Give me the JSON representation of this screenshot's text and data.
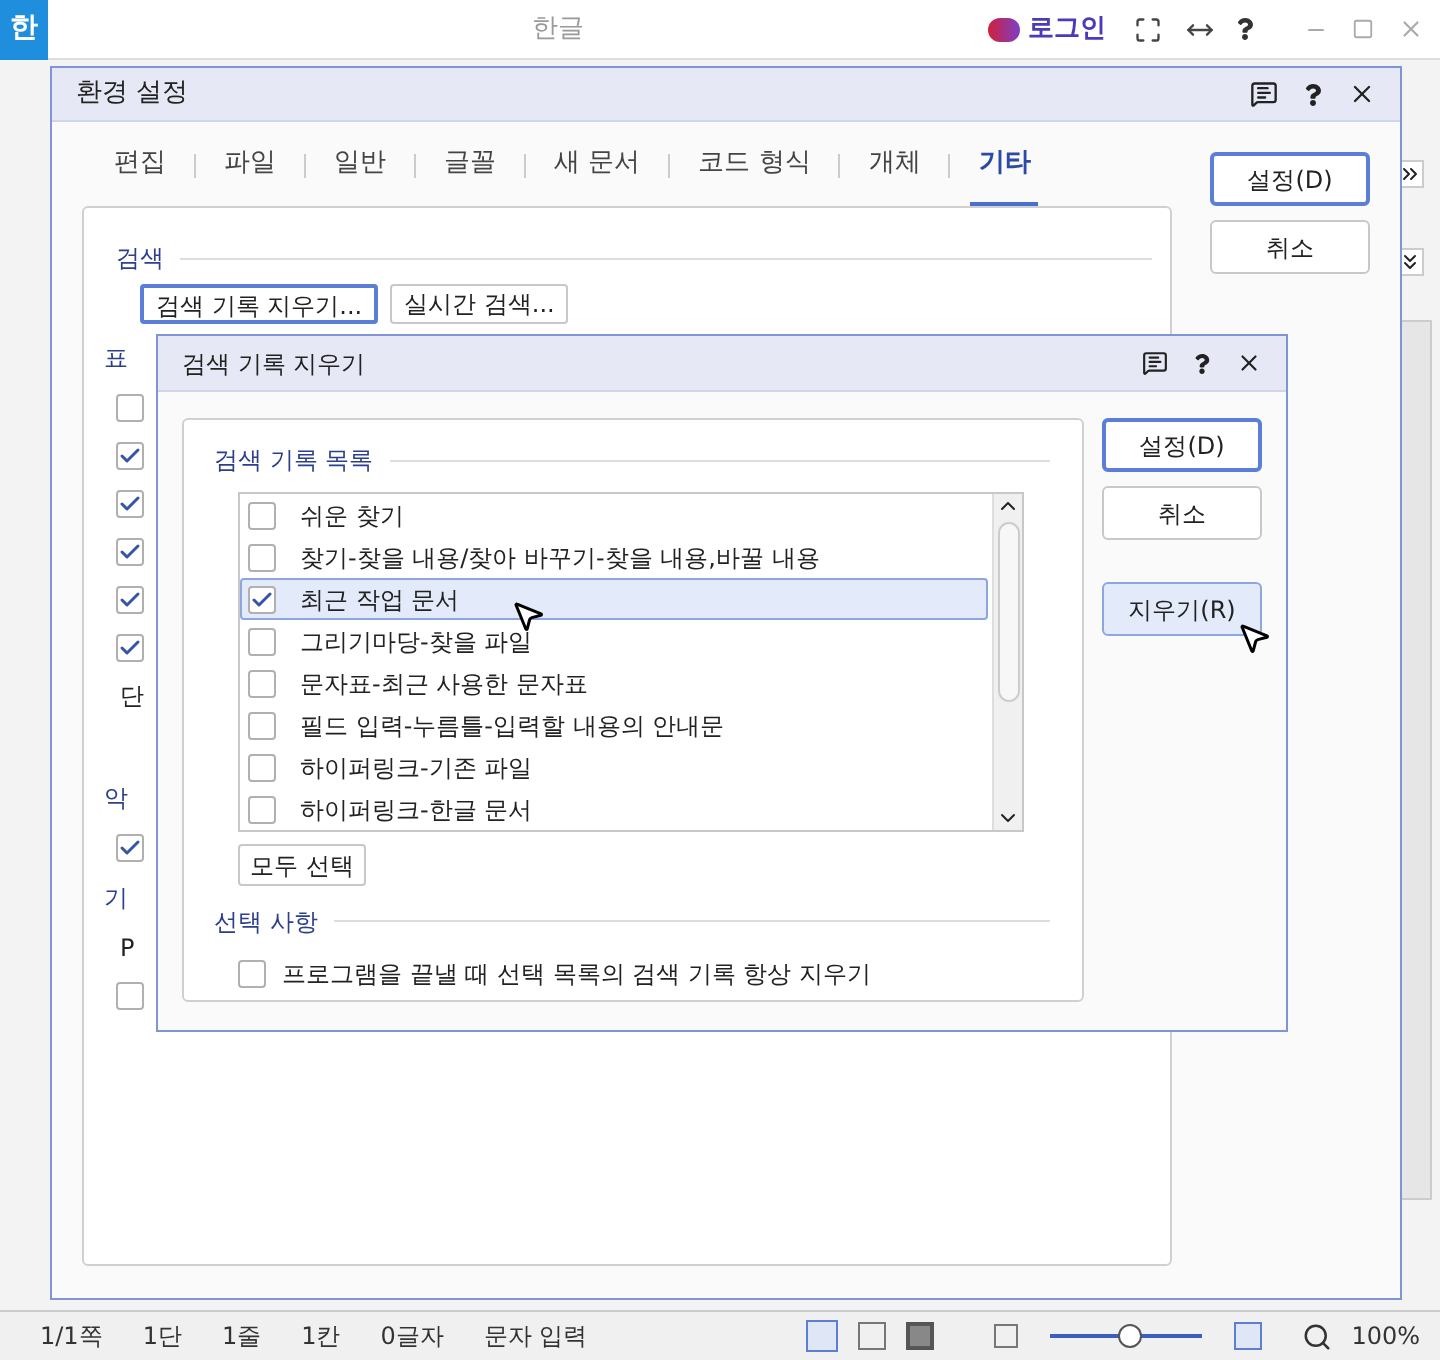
{
  "app": {
    "logo": "한",
    "title": "한글",
    "login": "로그인"
  },
  "settings_dialog": {
    "title": "환경 설정",
    "tabs": [
      {
        "label": "편집",
        "selected": false
      },
      {
        "label": "파일",
        "selected": false
      },
      {
        "label": "일반",
        "selected": false
      },
      {
        "label": "글꼴",
        "selected": false
      },
      {
        "label": "새 문서",
        "selected": false
      },
      {
        "label": "코드 형식",
        "selected": false
      },
      {
        "label": "개체",
        "selected": false
      },
      {
        "label": "기타",
        "selected": true
      }
    ],
    "buttons": [
      "설정(D)",
      "취소"
    ],
    "search_section": {
      "heading": "검색",
      "buttons": [
        "검색 기록 지우기...",
        "실시간 검색..."
      ]
    },
    "left_strip": [
      {
        "kind": "heading",
        "text": "표"
      },
      {
        "kind": "checkbox",
        "checked": false
      },
      {
        "kind": "checkbox",
        "checked": true
      },
      {
        "kind": "checkbox",
        "checked": true
      },
      {
        "kind": "checkbox",
        "checked": true
      },
      {
        "kind": "checkbox",
        "checked": true
      },
      {
        "kind": "checkbox",
        "checked": true
      },
      {
        "kind": "text",
        "text": "단"
      },
      {
        "kind": "gap"
      },
      {
        "kind": "heading",
        "text": "악"
      },
      {
        "kind": "checkbox",
        "checked": true
      },
      {
        "kind": "heading",
        "text": "기"
      },
      {
        "kind": "text",
        "text": "P"
      },
      {
        "kind": "checkbox",
        "checked": false
      }
    ]
  },
  "clear_history_dialog": {
    "title": "검색 기록 지우기",
    "list_heading": "검색 기록 목록",
    "items": [
      {
        "label": "쉬운 찾기",
        "checked": false,
        "selected": false
      },
      {
        "label": "찾기-찾을 내용/찾아 바꾸기-찾을 내용,바꿀 내용",
        "checked": false,
        "selected": false
      },
      {
        "label": "최근 작업 문서",
        "checked": true,
        "selected": true
      },
      {
        "label": "그리기마당-찾을 파일",
        "checked": false,
        "selected": false
      },
      {
        "label": "문자표-최근 사용한 문자표",
        "checked": false,
        "selected": false
      },
      {
        "label": "필드 입력-누름틀-입력할 내용의 안내문",
        "checked": false,
        "selected": false
      },
      {
        "label": "하이퍼링크-기존 파일",
        "checked": false,
        "selected": false
      },
      {
        "label": "하이퍼링크-한글 문서",
        "checked": false,
        "selected": false
      }
    ],
    "select_all": "모두 선택",
    "options_heading": "선택 사항",
    "options": [
      {
        "label": "프로그램을 끝낼 때 선택 목록의 검색 기록 항상 지우기",
        "checked": false
      }
    ],
    "buttons": [
      {
        "label": "설정(D)",
        "kind": "default"
      },
      {
        "label": "취소",
        "kind": "normal"
      },
      {
        "label": "지우기(R)",
        "kind": "hover"
      }
    ]
  },
  "status_bar": {
    "items": [
      "1/1쪽",
      "1단",
      "1줄",
      "1칸",
      "0글자",
      "문자 입력"
    ],
    "zoom": {
      "level": 0.53
    },
    "zoom_text": "100%"
  }
}
